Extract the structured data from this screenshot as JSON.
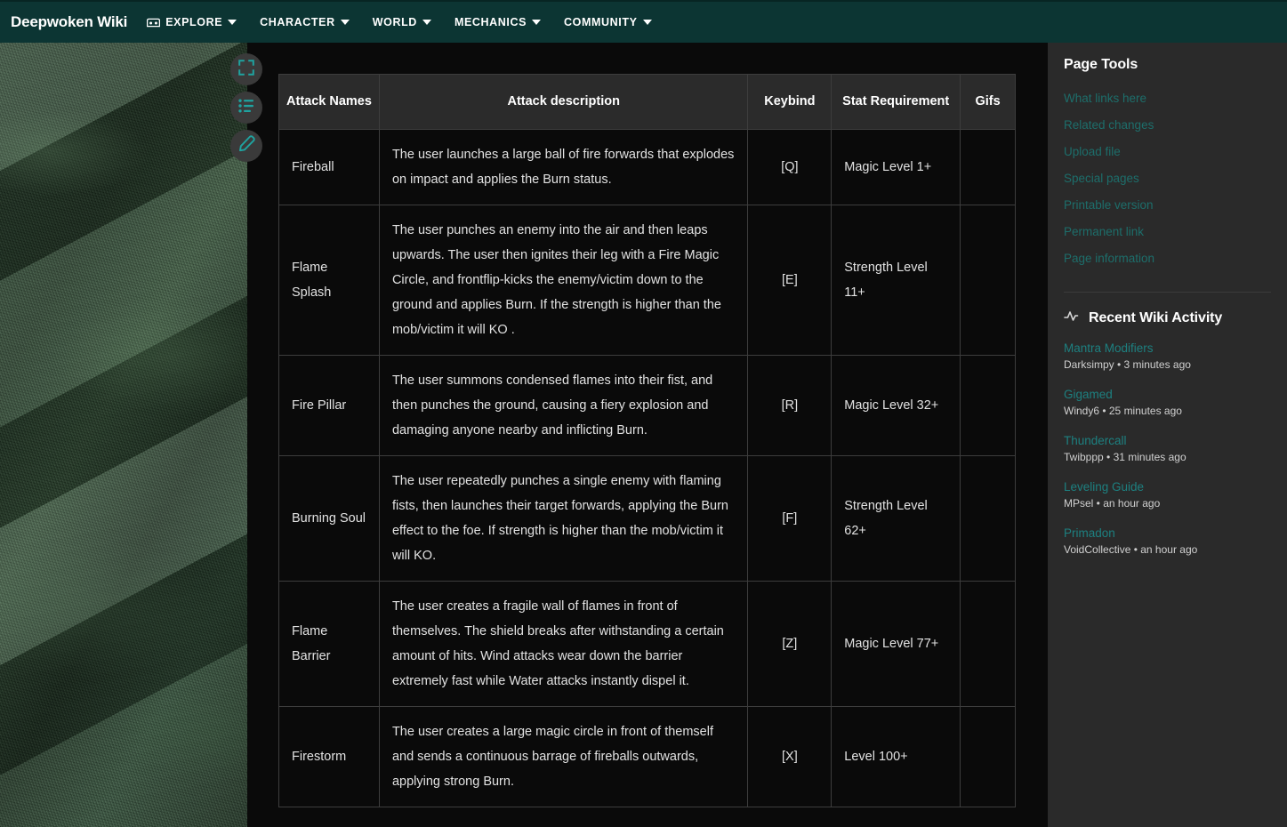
{
  "nav": {
    "brand": "Deepwoken Wiki",
    "items": [
      {
        "label": "EXPLORE",
        "icon": "compass-icon",
        "has_caret": true
      },
      {
        "label": "CHARACTER",
        "icon": null,
        "has_caret": true
      },
      {
        "label": "WORLD",
        "icon": null,
        "has_caret": true
      },
      {
        "label": "MECHANICS",
        "icon": null,
        "has_caret": true
      },
      {
        "label": "COMMUNITY",
        "icon": null,
        "has_caret": true
      }
    ]
  },
  "side_actions": [
    {
      "name": "fullscreen-icon"
    },
    {
      "name": "contents-list-icon"
    },
    {
      "name": "edit-pencil-icon"
    }
  ],
  "content": {
    "clipped_line": "",
    "table": {
      "headers": [
        "Attack Names",
        "Attack description",
        "Keybind",
        "Stat Requirement",
        "Gifs"
      ],
      "rows": [
        {
          "name": "Fireball",
          "description": "The user launches a large ball of fire forwards that explodes on impact and applies the Burn status.",
          "keybind": "[Q]",
          "stat": "Magic Level 1+",
          "gifs": ""
        },
        {
          "name": "Flame Splash",
          "description": "The user punches an enemy into the air and then leaps upwards. The user then ignites their leg with a Fire Magic Circle, and frontflip-kicks the enemy/victim down to the ground and applies Burn. If the strength is higher than the mob/victim it will KO .",
          "keybind": "[E]",
          "stat": "Strength Level 11+",
          "gifs": ""
        },
        {
          "name": "Fire Pillar",
          "description": "The user summons condensed flames into their fist, and then punches the ground, causing a fiery explosion and damaging anyone nearby and inflicting Burn.",
          "keybind": "[R]",
          "stat": "Magic Level 32+",
          "gifs": ""
        },
        {
          "name": "Burning Soul",
          "description": "The user repeatedly punches a single enemy with flaming fists, then launches their target forwards, applying the Burn effect to the foe. If strength is higher than the mob/victim it will KO.",
          "keybind": "[F]",
          "stat": "Strength Level 62+",
          "gifs": ""
        },
        {
          "name": "Flame Barrier",
          "description": "The user creates a fragile wall of flames in front of themselves. The shield breaks after withstanding a certain amount of hits. Wind attacks wear down the barrier extremely fast while Water attacks instantly dispel it.",
          "keybind": "[Z]",
          "stat": "Magic Level 77+",
          "gifs": ""
        },
        {
          "name": "Firestorm",
          "description": "The user creates a large magic circle in front of themself and sends a continuous barrage of fireballs outwards, applying strong Burn.",
          "keybind": "[X]",
          "stat": "Level 100+",
          "gifs": ""
        }
      ]
    }
  },
  "sidebar": {
    "page_tools": {
      "heading": "Page Tools",
      "links": [
        "What links here",
        "Related changes",
        "Upload file",
        "Special pages",
        "Printable version",
        "Permanent link",
        "Page information"
      ]
    },
    "recent_activity": {
      "heading": "Recent Wiki Activity",
      "icon": "activity-pulse-icon",
      "items": [
        {
          "title": "Mantra Modifiers",
          "meta": "Darksimpy • 3 minutes ago"
        },
        {
          "title": "Gigamed",
          "meta": "Windy6 • 25 minutes ago"
        },
        {
          "title": "Thundercall",
          "meta": "Twibppp • 31 minutes ago"
        },
        {
          "title": "Leveling Guide",
          "meta": "MPsel • an hour ago"
        },
        {
          "title": "Primadon",
          "meta": "VoidCollective • an hour ago"
        }
      ]
    }
  },
  "colors": {
    "nav_bg": "#0c3533",
    "accent_teal": "#1d8080",
    "link_teal": "#1d6e6b",
    "sidebar_bg": "#2a2a2a",
    "table_header_bg": "#2b2b2b",
    "table_body_bg": "#0a0a0a",
    "table_border": "#3d3d3d"
  }
}
